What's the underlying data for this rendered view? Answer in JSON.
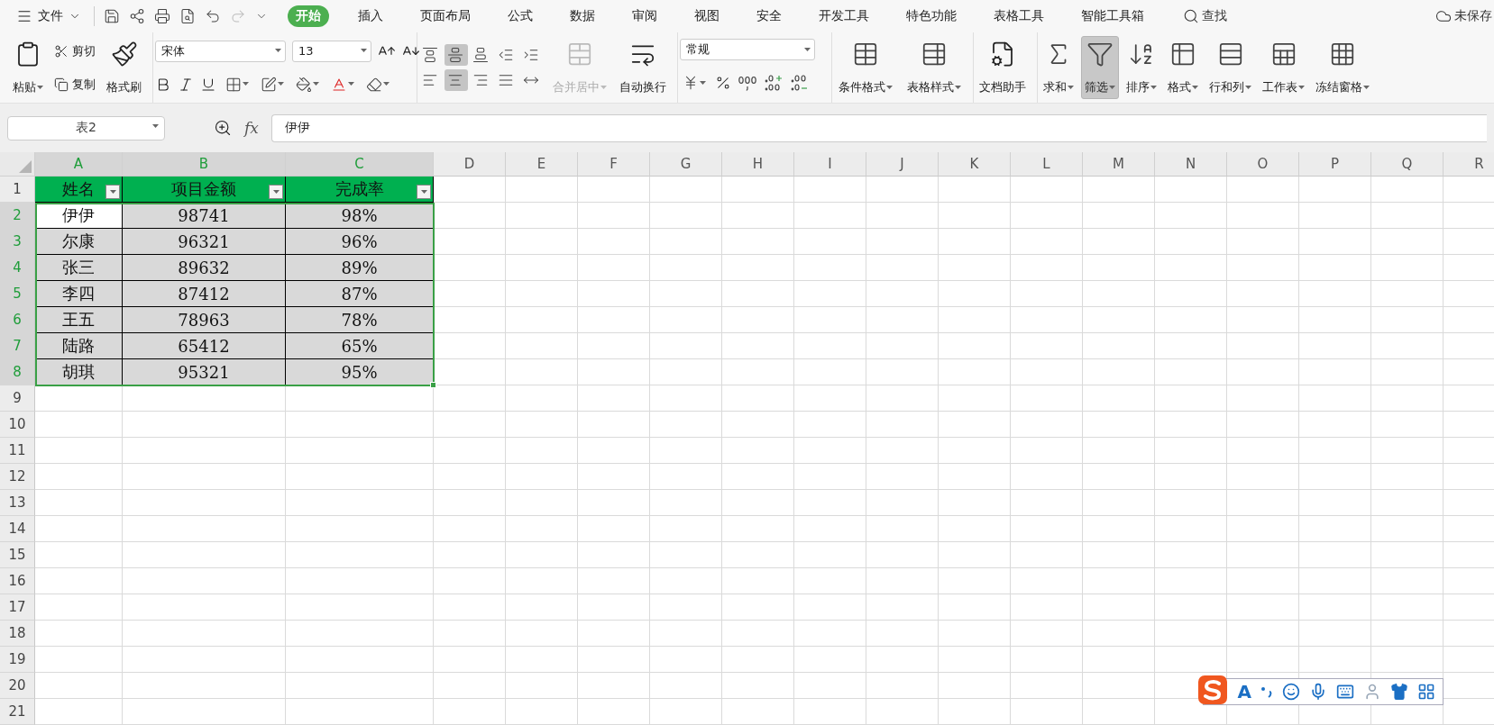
{
  "menu_bar": {
    "file_menu": "文件",
    "tabs": [
      {
        "label": "开始",
        "selected": true
      },
      {
        "label": "插入",
        "selected": false
      },
      {
        "label": "页面布局",
        "selected": false
      },
      {
        "label": "公式",
        "selected": false
      },
      {
        "label": "数据",
        "selected": false
      },
      {
        "label": "审阅",
        "selected": false
      },
      {
        "label": "视图",
        "selected": false
      },
      {
        "label": "安全",
        "selected": false
      },
      {
        "label": "开发工具",
        "selected": false
      },
      {
        "label": "特色功能",
        "selected": false
      },
      {
        "label": "表格工具",
        "selected": false
      },
      {
        "label": "智能工具箱",
        "selected": false
      }
    ],
    "search": "查找",
    "save_status": "未保存"
  },
  "ribbon": {
    "paste": "粘贴",
    "cut": "剪切",
    "copy": "复制",
    "format_painter": "格式刷",
    "font_name": "宋体",
    "font_size": "13",
    "align_buttons": [
      {
        "kind": "top",
        "selected": false
      },
      {
        "kind": "middle",
        "selected": true
      },
      {
        "kind": "bottom",
        "selected": false
      },
      {
        "kind": "outdent",
        "selected": false
      },
      {
        "kind": "indent",
        "selected": false
      },
      {
        "kind": "left",
        "selected": false
      },
      {
        "kind": "center",
        "selected": true
      },
      {
        "kind": "right",
        "selected": false
      },
      {
        "kind": "justify",
        "selected": false
      },
      {
        "kind": "distributed",
        "selected": false
      }
    ],
    "merge_center": {
      "label": "合并居中",
      "disabled": true
    },
    "wrap_text": "自动换行",
    "number_format": "常规",
    "style_tools": [
      {
        "kind": "conditional",
        "label": "条件格式",
        "selected": false
      },
      {
        "kind": "table-style",
        "label": "表格样式",
        "selected": false
      }
    ],
    "assistant": "文档助手",
    "edit_tools": [
      {
        "kind": "sum",
        "label": "求和",
        "selected": false
      },
      {
        "kind": "filter",
        "label": "筛选",
        "selected": true
      },
      {
        "kind": "sort",
        "label": "排序",
        "selected": false
      },
      {
        "kind": "format",
        "label": "格式",
        "selected": false
      },
      {
        "kind": "rowcol",
        "label": "行和列",
        "selected": false
      },
      {
        "kind": "sheet",
        "label": "工作表",
        "selected": false
      },
      {
        "kind": "freeze",
        "label": "冻结窗格",
        "selected": false
      }
    ]
  },
  "formula_bar": {
    "name_box": "表2",
    "fx": "fx",
    "value": "伊伊"
  },
  "sheet": {
    "columns": [
      {
        "label": "A",
        "selected": true
      },
      {
        "label": "B",
        "selected": true
      },
      {
        "label": "C",
        "selected": true
      },
      {
        "label": "D",
        "selected": false
      },
      {
        "label": "E",
        "selected": false
      },
      {
        "label": "F",
        "selected": false
      },
      {
        "label": "G",
        "selected": false
      },
      {
        "label": "H",
        "selected": false
      },
      {
        "label": "I",
        "selected": false
      },
      {
        "label": "J",
        "selected": false
      },
      {
        "label": "K",
        "selected": false
      },
      {
        "label": "L",
        "selected": false
      },
      {
        "label": "M",
        "selected": false
      },
      {
        "label": "N",
        "selected": false
      },
      {
        "label": "O",
        "selected": false
      },
      {
        "label": "P",
        "selected": false
      },
      {
        "label": "Q",
        "selected": false
      },
      {
        "label": "R",
        "selected": false
      }
    ],
    "rows": [
      {
        "label": "1",
        "selected": false
      },
      {
        "label": "2",
        "selected": true
      },
      {
        "label": "3",
        "selected": true
      },
      {
        "label": "4",
        "selected": true
      },
      {
        "label": "5",
        "selected": true
      },
      {
        "label": "6",
        "selected": true
      },
      {
        "label": "7",
        "selected": true
      },
      {
        "label": "8",
        "selected": true
      },
      {
        "label": "9",
        "selected": false
      },
      {
        "label": "10",
        "selected": false
      },
      {
        "label": "11",
        "selected": false
      },
      {
        "label": "12",
        "selected": false
      },
      {
        "label": "13",
        "selected": false
      },
      {
        "label": "14",
        "selected": false
      },
      {
        "label": "15",
        "selected": false
      },
      {
        "label": "16",
        "selected": false
      },
      {
        "label": "17",
        "selected": false
      },
      {
        "label": "18",
        "selected": false
      },
      {
        "label": "19",
        "selected": false
      },
      {
        "label": "20",
        "selected": false
      },
      {
        "label": "21",
        "selected": false
      }
    ],
    "table": {
      "header": [
        "姓名",
        "项目金额",
        "完成率"
      ],
      "rows": [
        {
          "cells": [
            {
              "text": "伊伊",
              "active": true
            },
            {
              "text": "98741",
              "active": false
            },
            {
              "text": "98%",
              "active": false
            }
          ]
        },
        {
          "cells": [
            {
              "text": "尔康",
              "active": false
            },
            {
              "text": "96321",
              "active": false
            },
            {
              "text": "96%",
              "active": false
            }
          ]
        },
        {
          "cells": [
            {
              "text": "张三",
              "active": false
            },
            {
              "text": "89632",
              "active": false
            },
            {
              "text": "89%",
              "active": false
            }
          ]
        },
        {
          "cells": [
            {
              "text": "李四",
              "active": false
            },
            {
              "text": "87412",
              "active": false
            },
            {
              "text": "87%",
              "active": false
            }
          ]
        },
        {
          "cells": [
            {
              "text": "王五",
              "active": false
            },
            {
              "text": "78963",
              "active": false
            },
            {
              "text": "78%",
              "active": false
            }
          ]
        },
        {
          "cells": [
            {
              "text": "陆路",
              "active": false
            },
            {
              "text": "65412",
              "active": false
            },
            {
              "text": "65%",
              "active": false
            }
          ]
        },
        {
          "cells": [
            {
              "text": "胡琪",
              "active": false
            },
            {
              "text": "95321",
              "active": false
            },
            {
              "text": "95%",
              "active": false
            }
          ]
        }
      ]
    }
  },
  "ime_toolbar": {
    "mode": "A"
  }
}
